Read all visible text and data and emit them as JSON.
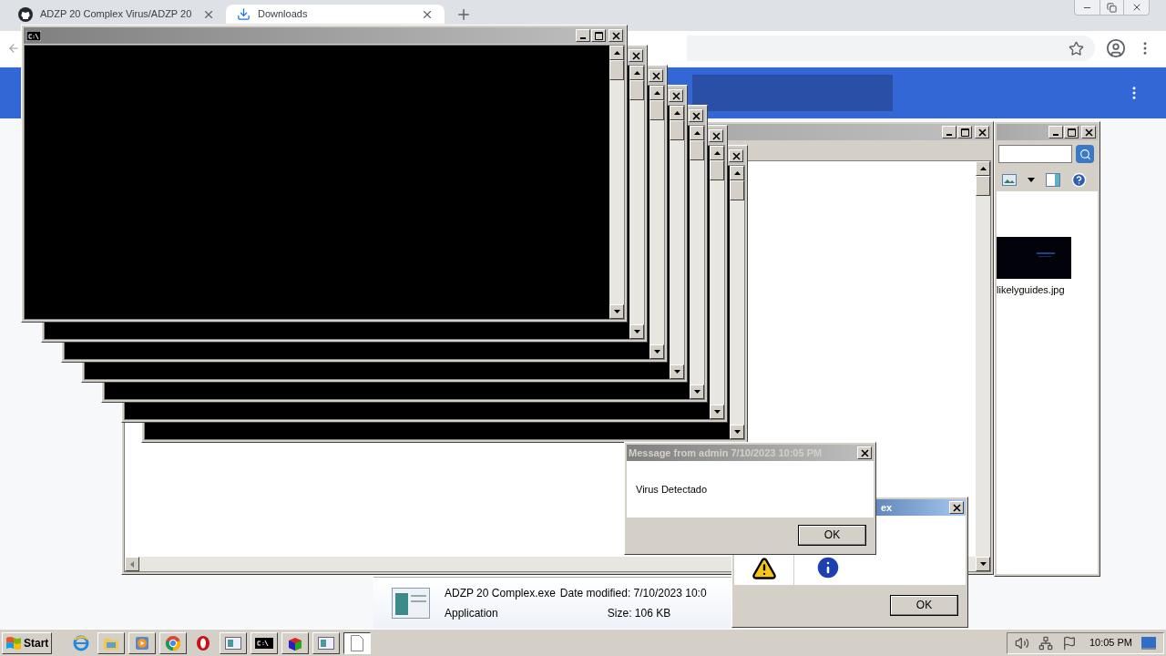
{
  "browser": {
    "tabs": [
      {
        "title": "ADZP 20 Complex Virus/ADZP 20",
        "selected": false
      },
      {
        "title": "Downloads",
        "selected": true
      }
    ]
  },
  "console_windows": [
    {
      "kind": "console"
    },
    {
      "kind": "console"
    },
    {
      "kind": "console"
    },
    {
      "kind": "console"
    },
    {
      "kind": "console"
    },
    {
      "kind": "console"
    },
    {
      "kind": "console"
    }
  ],
  "explorer": {
    "files": [
      {
        "name": "likelyguides.jpg"
      }
    ]
  },
  "details": {
    "file_name": "ADZP 20 Complex.exe",
    "file_type": "Application",
    "date_modified": "Date modified: 7/10/2023 10:0",
    "size": "Size: 106 KB"
  },
  "dialog": {
    "title": "ex",
    "button": "OK"
  },
  "message_box": {
    "title": "Message from admin 7/10/2023 10:05 PM",
    "text": "Virus Detectado",
    "button": "OK"
  },
  "taskbar": {
    "start": "Start",
    "items": [
      {
        "kind": "ie",
        "selected": false
      },
      {
        "kind": "folder",
        "selected": false
      },
      {
        "kind": "media",
        "selected": false
      },
      {
        "kind": "chrome",
        "selected": false
      },
      {
        "kind": "opera",
        "selected": false
      },
      {
        "kind": "window",
        "selected": false
      },
      {
        "kind": "console",
        "selected": false
      },
      {
        "kind": "cube",
        "selected": false
      },
      {
        "kind": "window",
        "selected": false
      },
      {
        "kind": "document",
        "selected": true
      }
    ],
    "clock": "10:05 PM"
  }
}
